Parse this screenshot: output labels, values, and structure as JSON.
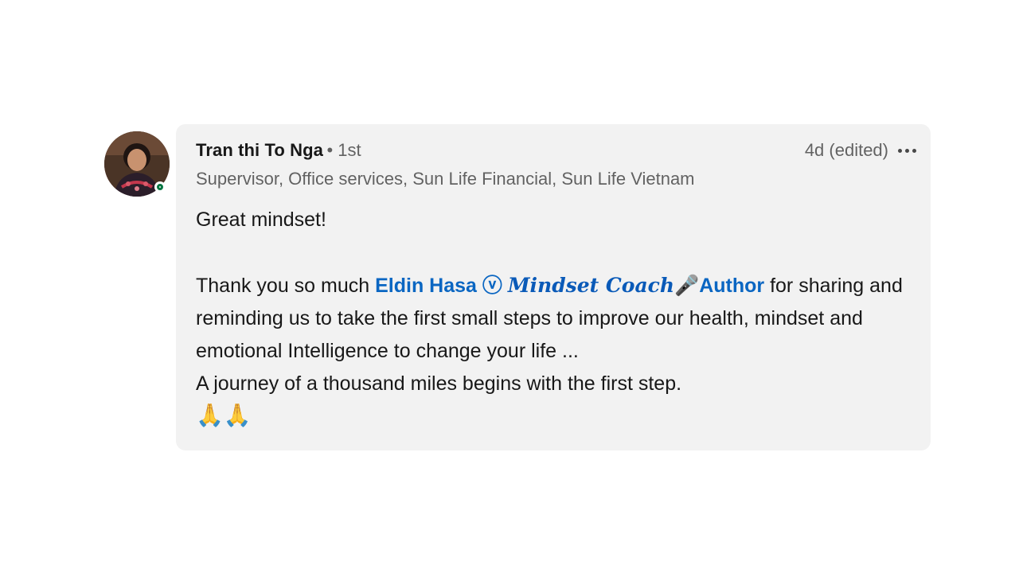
{
  "comment": {
    "author_name": "Tran thi To Nga",
    "degree": "• 1st",
    "headline": "Supervisor, Office services, Sun Life Financial, Sun Life Vietnam",
    "timestamp": "4d (edited)",
    "more_icon": "more-horizontal-icon",
    "avatar_icon": "profile-photo",
    "presence_color": "#057642",
    "body": {
      "line1": "Great mindset!",
      "thanks_prefix": "Thank you so much ",
      "mention_name": "Eldin Hasa ⓥ ",
      "mention_script": "𝑴𝒊𝒏𝒅𝒔𝒆𝒕 𝑪𝒐𝒂𝒄𝒉",
      "mention_mic": "🎤",
      "mention_suffix": "Author",
      "thanks_rest": " for sharing and reminding us to take the first small steps to improve our health, mindset and emotional Intelligence to change your life ...",
      "quote": "A journey of a thousand miles begins with the first step.",
      "emoji": "🙏🙏"
    }
  },
  "colors": {
    "bubble_bg": "#f2f2f2",
    "mention": "#0a66c2"
  }
}
